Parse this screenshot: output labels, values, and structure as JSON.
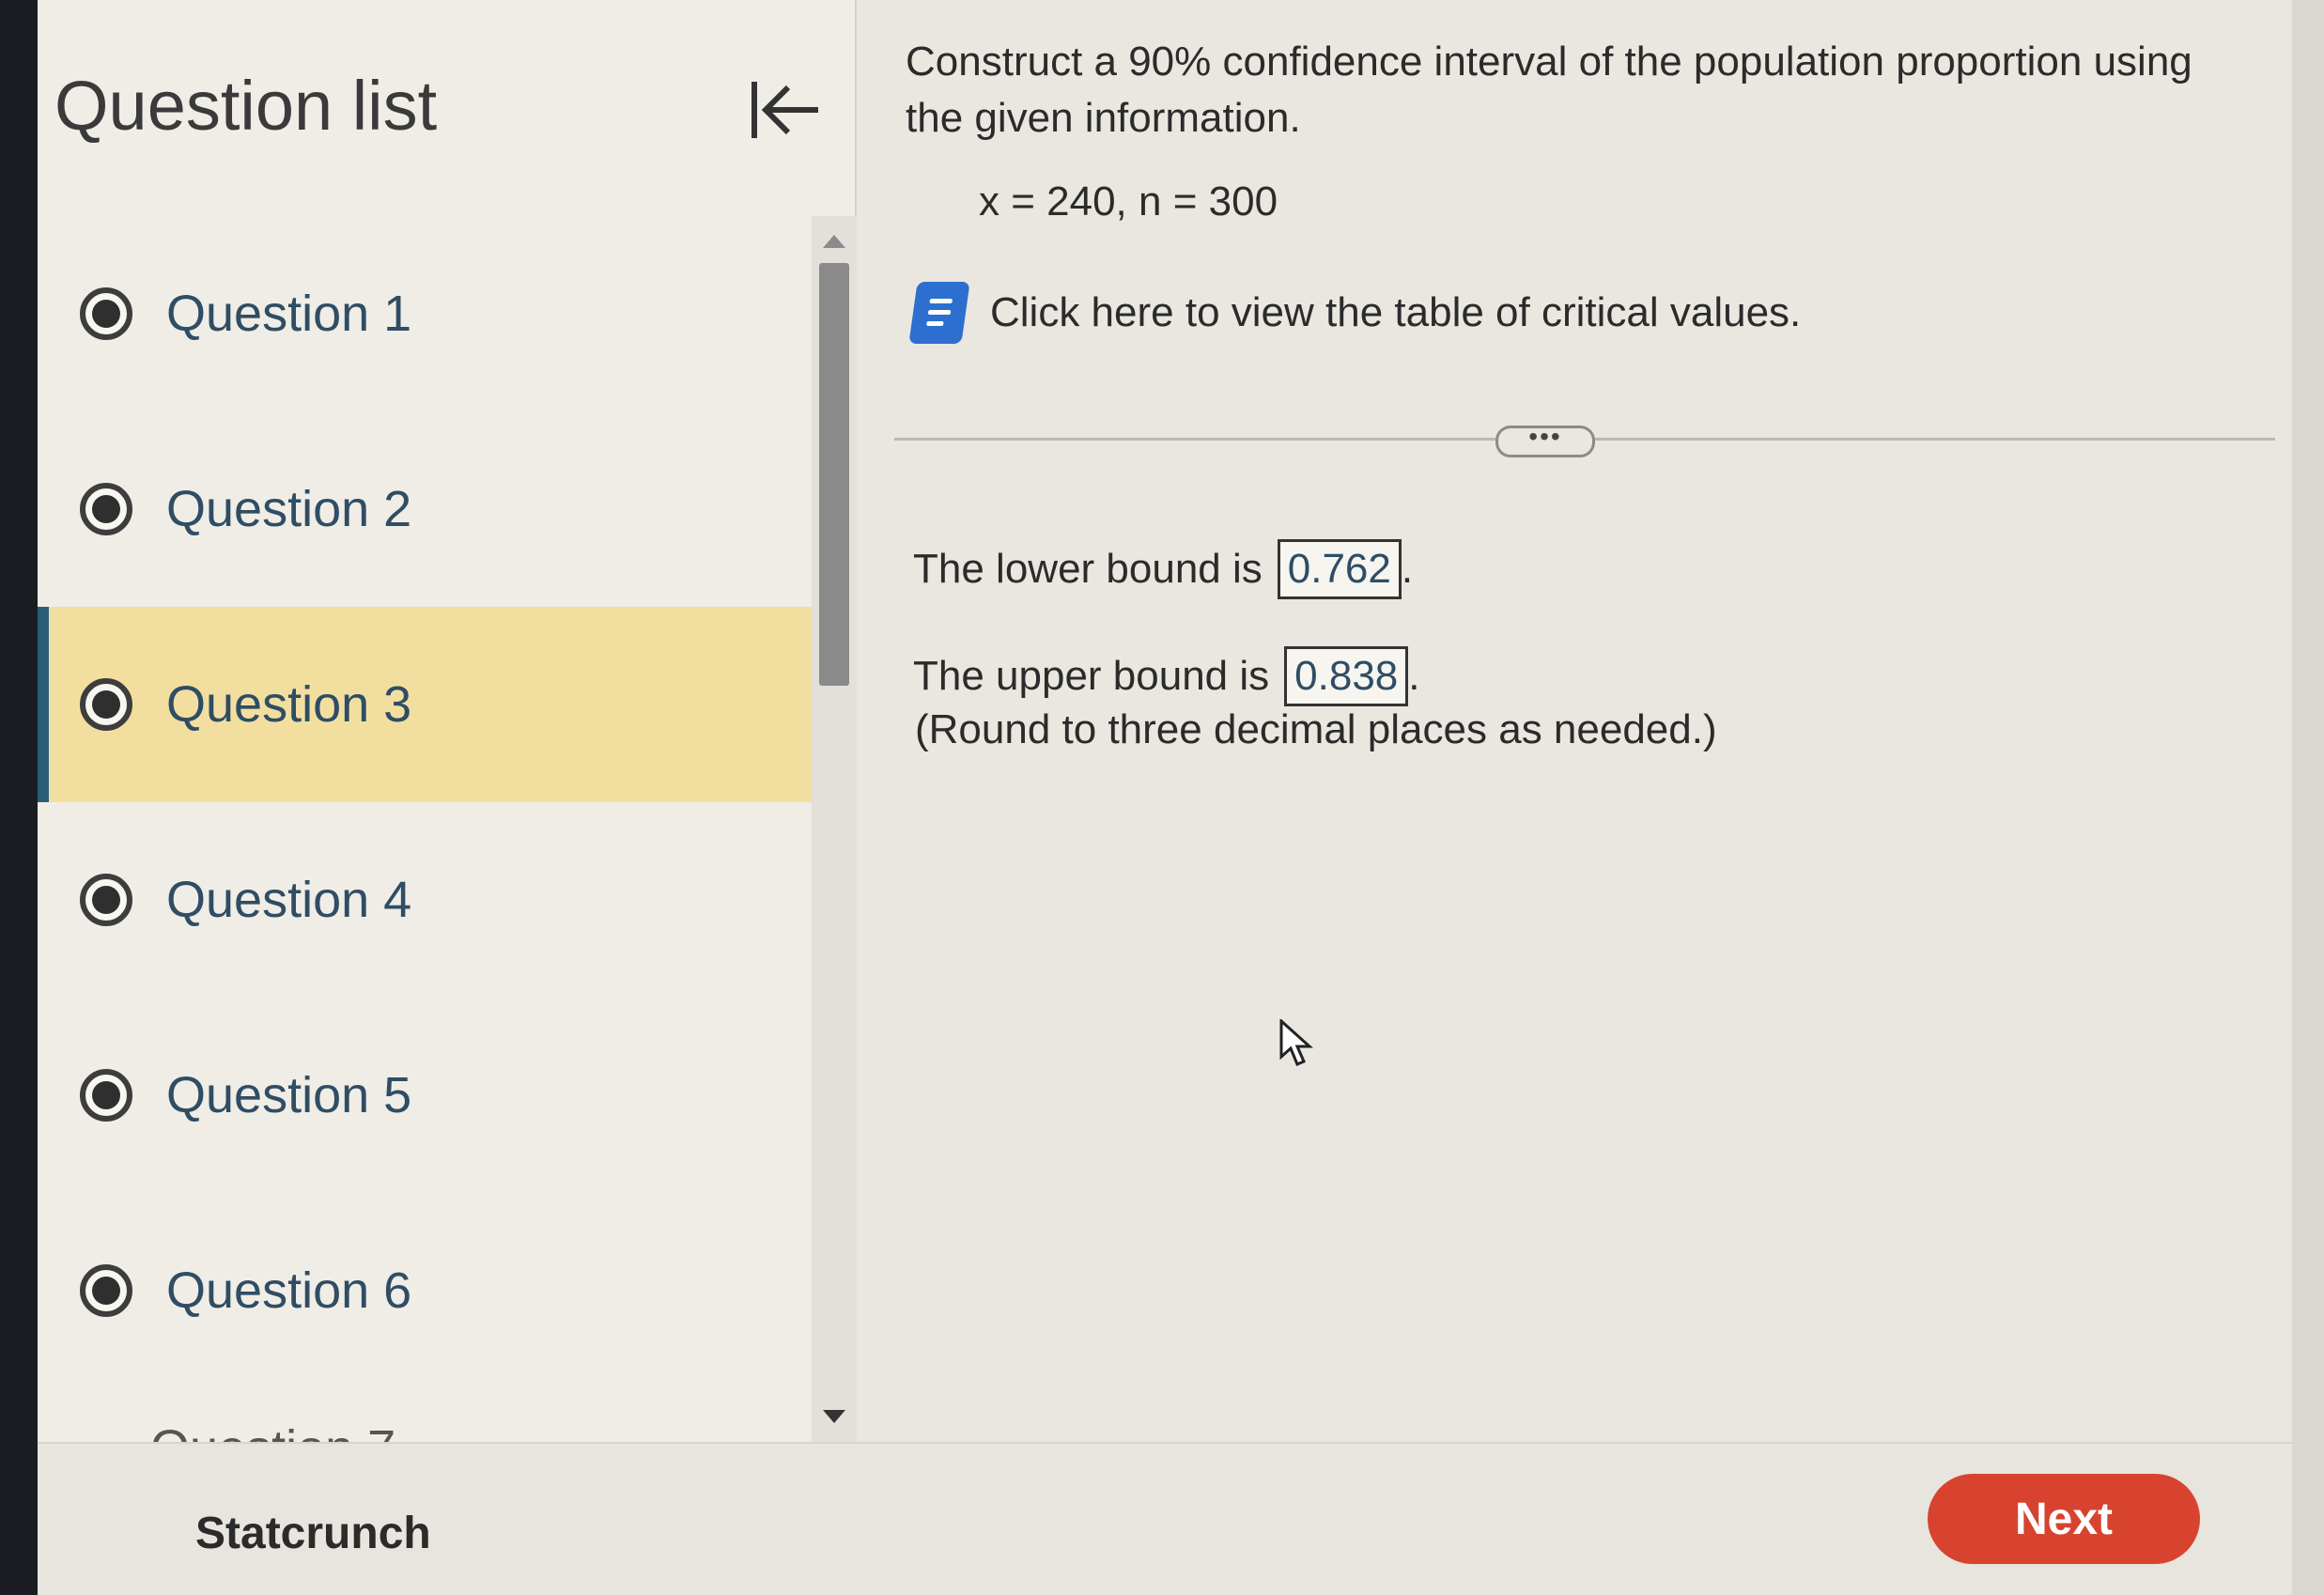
{
  "sidebar": {
    "title": "Question list",
    "questions": [
      {
        "label": "Question 1"
      },
      {
        "label": "Question 2"
      },
      {
        "label": "Question 3"
      },
      {
        "label": "Question 4"
      },
      {
        "label": "Question 5"
      },
      {
        "label": "Question 6"
      }
    ],
    "active_index": 2,
    "partial_next_label": "Question 7"
  },
  "main": {
    "question": "Construct a 90% confidence interval of the population proportion using the given information.",
    "given": "x = 240, n = 300",
    "table_link": "Click here to view the table of critical values.",
    "expand_label": "•••",
    "lower": {
      "prefix": "The lower bound is",
      "value": "0.762",
      "suffix": "."
    },
    "upper": {
      "prefix": "The upper bound is",
      "value": "0.838",
      "suffix": "."
    },
    "round_note": "(Round to three decimal places as needed.)"
  },
  "footer": {
    "statcrunch": "Statcrunch",
    "next": "Next"
  },
  "colors": {
    "active_item_bg": "#f2dfa0",
    "active_item_border": "#2a5e77",
    "next_button": "#d8432f",
    "book_icon": "#2d6fd0"
  },
  "icons": [
    "collapse-arrow-icon",
    "radio-icon",
    "book-icon",
    "mouse-cursor-icon"
  ]
}
